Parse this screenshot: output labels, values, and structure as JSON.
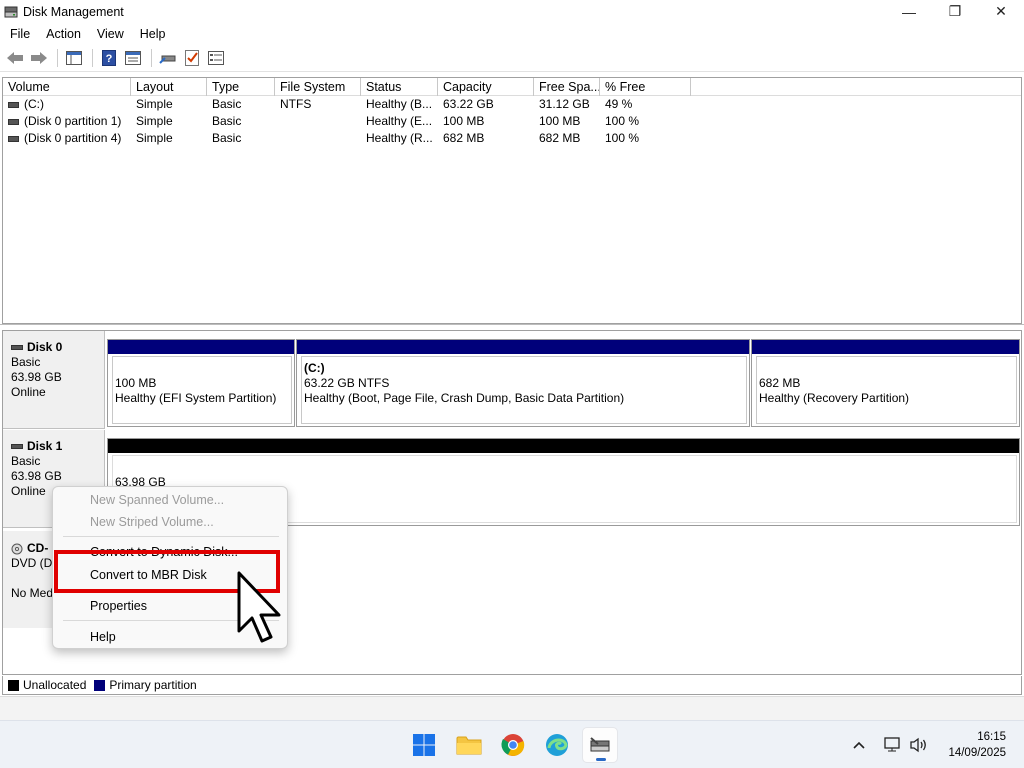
{
  "window": {
    "title": "Disk Management",
    "minimize_glyph": "—",
    "restore_glyph": "❐",
    "close_glyph": "✕"
  },
  "menu": [
    "File",
    "Action",
    "View",
    "Help"
  ],
  "toolbar": {
    "icons": [
      "back-arrow-icon",
      "forward-arrow-icon",
      "show-hide-console-tree-icon",
      "help-icon",
      "properties-icon",
      "connect-drive-icon",
      "rescan-check-icon",
      "settings-list-icon"
    ]
  },
  "volume_list": {
    "columns": [
      "Volume",
      "Layout",
      "Type",
      "File System",
      "Status",
      "Capacity",
      "Free Spa...",
      "% Free"
    ],
    "rows": [
      [
        "(C:)",
        "Simple",
        "Basic",
        "NTFS",
        "Healthy (B...",
        "63.22 GB",
        "31.12 GB",
        "49 %"
      ],
      [
        "(Disk 0 partition 1)",
        "Simple",
        "Basic",
        "",
        "Healthy (E...",
        "100 MB",
        "100 MB",
        "100 %"
      ],
      [
        "(Disk 0 partition 4)",
        "Simple",
        "Basic",
        "",
        "Healthy (R...",
        "682 MB",
        "682 MB",
        "100 %"
      ]
    ]
  },
  "disks": [
    {
      "name": "Disk 0",
      "type": "Basic",
      "size": "63.98 GB",
      "state": "Online",
      "partitions": [
        {
          "title": "",
          "size": "100 MB",
          "status": "Healthy (EFI System Partition)"
        },
        {
          "title": "(C:)",
          "size": "63.22 GB NTFS",
          "status": "Healthy (Boot, Page File, Crash Dump, Basic Data Partition)"
        },
        {
          "title": "",
          "size": "682 MB",
          "status": "Healthy (Recovery Partition)"
        }
      ]
    },
    {
      "name": "Disk 1",
      "type": "Basic",
      "size": "63.98 GB",
      "state": "Online",
      "partitions": [
        {
          "title": "",
          "size": "63.98 GB",
          "status": ""
        }
      ]
    }
  ],
  "cdrom": {
    "name": "CD-",
    "type": "DVD (D:",
    "state": "No Med"
  },
  "legend": [
    {
      "label": "Unallocated",
      "color": "#000000"
    },
    {
      "label": "Primary partition",
      "color": "#00007a"
    }
  ],
  "context_menu": {
    "items": [
      {
        "label": "New Spanned Volume...",
        "enabled": false
      },
      {
        "label": "New Striped Volume...",
        "enabled": false
      },
      {
        "label": "Convert to Dynamic Disk...",
        "enabled": true
      },
      {
        "label": "Convert to MBR Disk",
        "enabled": true
      },
      {
        "label": "Properties",
        "enabled": true
      },
      {
        "label": "Help",
        "enabled": true
      }
    ],
    "highlight_color": "#e00000"
  },
  "taskbar": {
    "apps": [
      "start-icon",
      "file-explorer-icon",
      "chrome-icon",
      "edge-icon",
      "disk-management-icon"
    ],
    "tray_icons": [
      "chevron-up-icon",
      "network-icon",
      "volume-icon"
    ],
    "time": "16:15",
    "date": "14/09/2025"
  }
}
